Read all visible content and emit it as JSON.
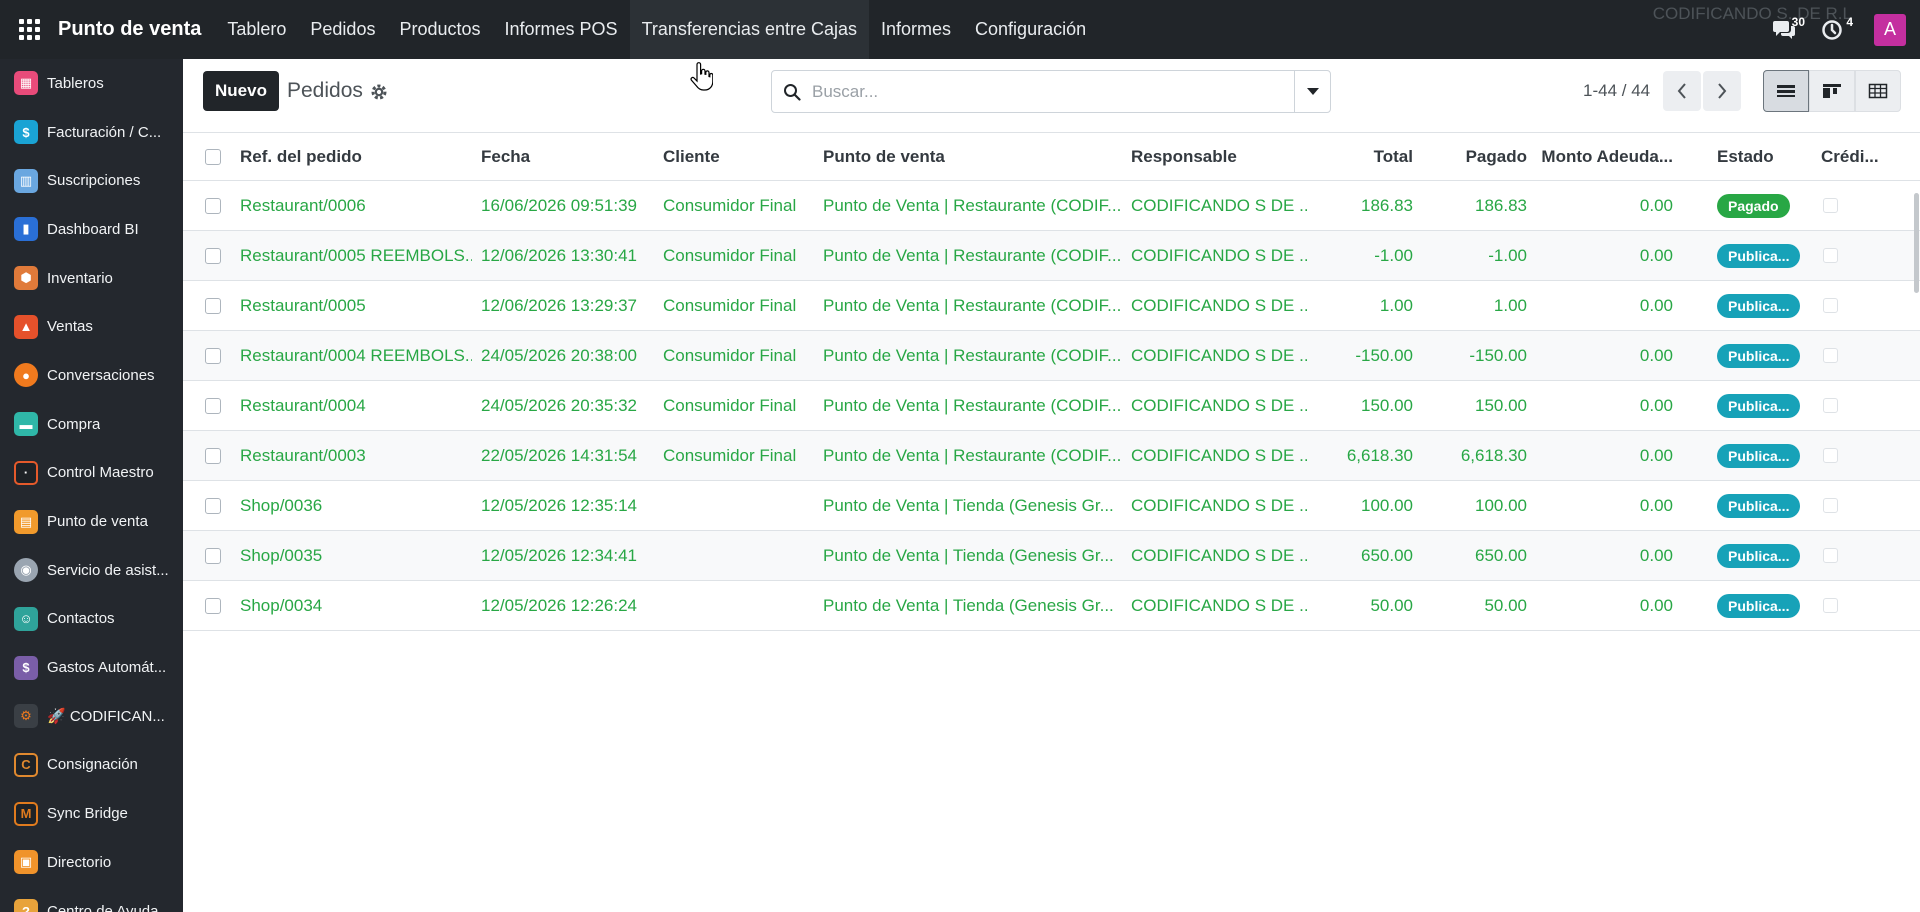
{
  "topbar": {
    "app_name": "Punto de venta",
    "menu": [
      "Tablero",
      "Pedidos",
      "Productos",
      "Informes POS",
      "Transferencias entre Cajas",
      "Informes",
      "Configuración"
    ],
    "messages_count": "30",
    "activities_count": "4",
    "company": "CODIFICANDO S. DE R.L",
    "avatar_letter": "A"
  },
  "sidebar": {
    "items": [
      {
        "label": "Tableros",
        "icon": "dashboards-icon",
        "color": "#e84b7a"
      },
      {
        "label": "Facturación / C...",
        "icon": "invoicing-icon",
        "color": "#1aa3d4"
      },
      {
        "label": "Suscripciones",
        "icon": "subscriptions-icon",
        "color": "#6aa7e0"
      },
      {
        "label": "Dashboard BI",
        "icon": "bar-chart-icon",
        "color": "#2a6fd6"
      },
      {
        "label": "Inventario",
        "icon": "inventory-box-icon",
        "color": "#e07a3a"
      },
      {
        "label": "Ventas",
        "icon": "sales-chart-icon",
        "color": "#e5512b"
      },
      {
        "label": "Conversaciones",
        "icon": "chat-bubble-icon",
        "color": "#f07a1e"
      },
      {
        "label": "Compra",
        "icon": "purchase-card-icon",
        "color": "#2fb7a8"
      },
      {
        "label": "Control Maestro",
        "icon": "control-master-icon",
        "color": "#e55a2b"
      },
      {
        "label": "Punto de venta",
        "icon": "store-awning-icon",
        "color": "#f19a2c"
      },
      {
        "label": "Servicio de asist...",
        "icon": "helpdesk-lifebuoy-icon",
        "color": "#9aa5b1"
      },
      {
        "label": "Contactos",
        "icon": "contacts-icon",
        "color": "#2fa39a"
      },
      {
        "label": "Gastos Automát...",
        "icon": "expenses-icon",
        "color": "#7a5ea8"
      },
      {
        "label": "🚀 CODIFICAN...",
        "icon": "codificando-gear-icon",
        "color": "#3a3f45"
      },
      {
        "label": "Consignación",
        "icon": "consignment-c-icon",
        "color": "#e0892f"
      },
      {
        "label": "Sync Bridge",
        "icon": "sync-bridge-m-icon",
        "color": "#e07b1e"
      },
      {
        "label": "Directorio",
        "icon": "directory-building-icon",
        "color": "#f0932b"
      },
      {
        "label": "Centro de Ayuda",
        "icon": "help-center-icon",
        "color": "#e8a33b"
      }
    ]
  },
  "control_panel": {
    "new_label": "Nuevo",
    "title": "Pedidos",
    "search_placeholder": "Buscar...",
    "pager": "1-44 / 44"
  },
  "table": {
    "headers": [
      "Ref. del pedido",
      "Fecha",
      "Cliente",
      "Punto de venta",
      "Responsable",
      "Total",
      "Pagado",
      "Monto Adeuda...",
      "Estado",
      "Crédi..."
    ],
    "rows": [
      {
        "ref": "Restaurant/0006",
        "fecha": "16/06/2026 09:51:39",
        "cliente": "Consumidor Final",
        "pos": "Punto de Venta | Restaurante (CODIF...",
        "resp": "CODIFICANDO S DE ...",
        "total": "186.83",
        "pagado": "186.83",
        "monto": "0.00",
        "estado": "Pagado",
        "estado_color": "#28a745"
      },
      {
        "ref": "Restaurant/0005 REEMBOLS...",
        "fecha": "12/06/2026 13:30:41",
        "cliente": "Consumidor Final",
        "pos": "Punto de Venta | Restaurante (CODIF...",
        "resp": "CODIFICANDO S DE ...",
        "total": "-1.00",
        "pagado": "-1.00",
        "monto": "0.00",
        "estado": "Publica...",
        "estado_color": "#17a2b8"
      },
      {
        "ref": "Restaurant/0005",
        "fecha": "12/06/2026 13:29:37",
        "cliente": "Consumidor Final",
        "pos": "Punto de Venta | Restaurante (CODIF...",
        "resp": "CODIFICANDO S DE ...",
        "total": "1.00",
        "pagado": "1.00",
        "monto": "0.00",
        "estado": "Publica...",
        "estado_color": "#17a2b8"
      },
      {
        "ref": "Restaurant/0004 REEMBOLS...",
        "fecha": "24/05/2026 20:38:00",
        "cliente": "Consumidor Final",
        "pos": "Punto de Venta | Restaurante (CODIF...",
        "resp": "CODIFICANDO S DE ...",
        "total": "-150.00",
        "pagado": "-150.00",
        "monto": "0.00",
        "estado": "Publica...",
        "estado_color": "#17a2b8"
      },
      {
        "ref": "Restaurant/0004",
        "fecha": "24/05/2026 20:35:32",
        "cliente": "Consumidor Final",
        "pos": "Punto de Venta | Restaurante (CODIF...",
        "resp": "CODIFICANDO S DE ...",
        "total": "150.00",
        "pagado": "150.00",
        "monto": "0.00",
        "estado": "Publica...",
        "estado_color": "#17a2b8"
      },
      {
        "ref": "Restaurant/0003",
        "fecha": "22/05/2026 14:31:54",
        "cliente": "Consumidor Final",
        "pos": "Punto de Venta | Restaurante (CODIF...",
        "resp": "CODIFICANDO S DE ...",
        "total": "6,618.30",
        "pagado": "6,618.30",
        "monto": "0.00",
        "estado": "Publica...",
        "estado_color": "#17a2b8"
      },
      {
        "ref": "Shop/0036",
        "fecha": "12/05/2026 12:35:14",
        "cliente": "",
        "pos": "Punto de Venta | Tienda (Genesis Gr...",
        "resp": "CODIFICANDO S DE ...",
        "total": "100.00",
        "pagado": "100.00",
        "monto": "0.00",
        "estado": "Publica...",
        "estado_color": "#17a2b8"
      },
      {
        "ref": "Shop/0035",
        "fecha": "12/05/2026 12:34:41",
        "cliente": "",
        "pos": "Punto de Venta | Tienda (Genesis Gr...",
        "resp": "CODIFICANDO S DE ...",
        "total": "650.00",
        "pagado": "650.00",
        "monto": "0.00",
        "estado": "Publica...",
        "estado_color": "#17a2b8"
      },
      {
        "ref": "Shop/0034",
        "fecha": "12/05/2026 12:26:24",
        "cliente": "",
        "pos": "Punto de Venta | Tienda (Genesis Gr...",
        "resp": "CODIFICANDO S DE ...",
        "total": "50.00",
        "pagado": "50.00",
        "monto": "0.00",
        "estado": "Publica...",
        "estado_color": "#17a2b8"
      }
    ]
  },
  "colors": {
    "topbar_bg": "#212529",
    "sidebar_bg": "#24282e",
    "link_green": "#28a745",
    "status_paid": "#28a745",
    "status_posted": "#17a2b8",
    "avatar": "#c42f9f"
  }
}
